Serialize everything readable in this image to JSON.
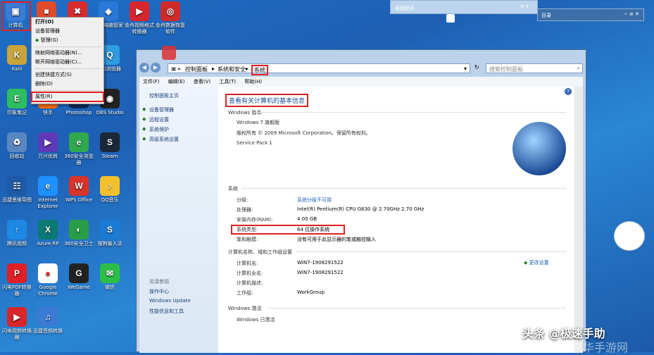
{
  "desktop": {
    "icons": [
      {
        "label": "计算机",
        "color": "#3a7bd5",
        "glyph": "▣"
      },
      {
        "label": "",
        "color": "#e04b2a",
        "glyph": "■"
      },
      {
        "label": "",
        "color": "#d92b2b",
        "glyph": "✖"
      },
      {
        "label": "腾讯电脑管家",
        "color": "#2a79d8",
        "glyph": "◈"
      },
      {
        "label": "金舟视频格式转换器",
        "color": "#d7262d",
        "glyph": "▶"
      },
      {
        "label": "金舟数据恢复软件",
        "color": "#cf2b2b",
        "glyph": "◎"
      },
      {
        "label": "Kaili",
        "color": "#c9a43c",
        "glyph": "K"
      },
      {
        "label": "EasyConnect",
        "color": "#1a8ad6",
        "glyph": "⇄"
      },
      {
        "label": "Microsoft Word",
        "color": "#2b5797",
        "glyph": "W"
      },
      {
        "label": "QQ浏览器",
        "color": "#2f9be0",
        "glyph": "Q"
      },
      {
        "label": "印象笔记",
        "color": "#2dbe60",
        "glyph": "E"
      },
      {
        "label": "快手",
        "color": "#ff6a00",
        "glyph": "K"
      },
      {
        "label": "Photoshop",
        "color": "#0a2b5a",
        "glyph": "Ps"
      },
      {
        "label": "OBS Studio",
        "color": "#222222",
        "glyph": "◉"
      },
      {
        "label": "回收站",
        "color": "#5b87c0",
        "glyph": "♻"
      },
      {
        "label": "万兴优转",
        "color": "#5e3ab8",
        "glyph": "▶"
      },
      {
        "label": "360安全浏览器",
        "color": "#2fa84f",
        "glyph": "e"
      },
      {
        "label": "Steam",
        "color": "#1b2838",
        "glyph": "S"
      },
      {
        "label": "迅捷思维导图",
        "color": "#1f5aa6",
        "glyph": "☷"
      },
      {
        "label": "Internet Explorer",
        "color": "#1e90ff",
        "glyph": "e"
      },
      {
        "label": "WPS Office",
        "color": "#d9342b",
        "glyph": "W"
      },
      {
        "label": "QQ音乐",
        "color": "#f3c12d",
        "glyph": "♪"
      },
      {
        "label": "腾讯视频",
        "color": "#1e88e5",
        "glyph": "↑"
      },
      {
        "label": "Azure RP",
        "color": "#0b7a75",
        "glyph": "X"
      },
      {
        "label": "360安全卫士",
        "color": "#2a9d49",
        "glyph": "◐"
      },
      {
        "label": "搜狗输入法",
        "color": "#1a7ad4",
        "glyph": "S"
      },
      {
        "label": "闪电PDF转换器",
        "color": "#e01f26",
        "glyph": "P"
      },
      {
        "label": "Google Chrome",
        "color": "#ffffff",
        "glyph": "●"
      },
      {
        "label": "WeGame",
        "color": "#222222",
        "glyph": "G"
      },
      {
        "label": "微信",
        "color": "#2dbe45",
        "glyph": "✉"
      },
      {
        "label": "闪电视频转换器",
        "color": "#d8262b",
        "glyph": "▶"
      },
      {
        "label": "迅捷音频转换",
        "color": "#3a7bd5",
        "glyph": "♫"
      }
    ]
  },
  "context_menu": {
    "items": [
      "打开(O)",
      "设备管理器",
      "管理(G)",
      "映射网络驱动器(N)...",
      "断开网络驱动器(C)...",
      "创建快捷方式(S)",
      "删除(D)",
      "属性(R)"
    ]
  },
  "gadgets": {
    "desktop_helper": "桌面助手",
    "catalog": "目录"
  },
  "window": {
    "breadcrumb": [
      "控制面板",
      "系统和安全",
      "系统"
    ],
    "search_placeholder": "搜索控制面板",
    "menu": [
      "文件(F)",
      "编辑(E)",
      "查看(V)",
      "工具(T)",
      "帮助(H)"
    ],
    "left_nav": {
      "home": "控制面板主页",
      "links": [
        "设备管理器",
        "远程设置",
        "系统保护",
        "高级系统设置"
      ],
      "see_also_title": "另请参阅",
      "see_also": [
        "操作中心",
        "Windows Update",
        "性能信息和工具"
      ]
    },
    "title": "查看有关计算机的基本信息",
    "windows_edition": {
      "section": "Windows 版本",
      "name": "Windows 7 旗舰版",
      "copyright": "版权所有 © 2009 Microsoft Corporation。保留所有权利。",
      "sp": "Service Pack 1"
    },
    "system": {
      "section": "系统",
      "rows": [
        {
          "k": "分级:",
          "v": "系统分级不可用",
          "link": true
        },
        {
          "k": "处理器:",
          "v": "Intel(R) Pentium(R) CPU G630 @ 2.70GHz   2.70 GHz"
        },
        {
          "k": "安装内存(RAM):",
          "v": "4.00 GB"
        },
        {
          "k": "系统类型:",
          "v": "64 位操作系统"
        },
        {
          "k": "笔和触摸:",
          "v": "没有可用于此显示器的笔或触控输入"
        }
      ]
    },
    "computer": {
      "section": "计算机名称、域和工作组设置",
      "change": "更改设置",
      "rows": [
        {
          "k": "计算机名:",
          "v": "WIN7-1908291522"
        },
        {
          "k": "计算机全名:",
          "v": "WIN7-1908291522"
        },
        {
          "k": "计算机描述:",
          "v": ""
        },
        {
          "k": "工作组:",
          "v": "WorkGroup"
        }
      ]
    },
    "activation": {
      "section": "Windows 激活",
      "status": "Windows 已激活"
    }
  },
  "watermark": {
    "brand": "头条 @极速手助",
    "site": "京华手游网"
  }
}
